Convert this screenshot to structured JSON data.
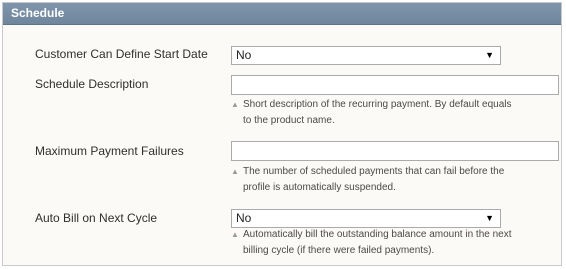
{
  "section": {
    "title": "Schedule"
  },
  "fields": {
    "start_date": {
      "label": "Customer Can Define Start Date",
      "value": "No"
    },
    "description": {
      "label": "Schedule Description",
      "value": "",
      "note": "Short description of the recurring payment. By default equals to the product name."
    },
    "max_failures": {
      "label": "Maximum Payment Failures",
      "value": "",
      "note": "The number of scheduled payments that can fail before the profile is automatically suspended."
    },
    "auto_bill": {
      "label": "Auto Bill on Next Cycle",
      "value": "No",
      "note": "Automatically bill the outstanding balance amount in the next billing cycle (if there were failed payments)."
    }
  },
  "icons": {
    "dropdown": "chevron-down-icon",
    "note": "note-triangle-icon"
  }
}
